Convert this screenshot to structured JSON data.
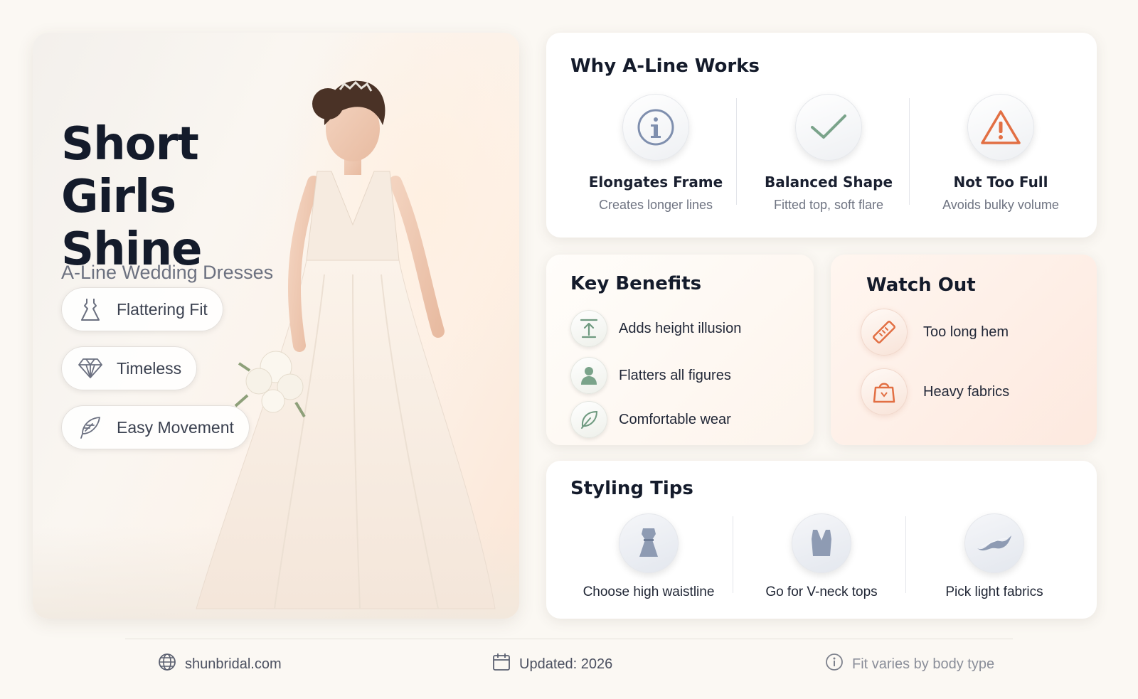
{
  "hero": {
    "title": "Short Girls Shine",
    "subtitle": "A-Line Wedding Dresses",
    "pills": [
      {
        "label": "Flattering Fit",
        "icon": "dress-icon"
      },
      {
        "label": "Timeless",
        "icon": "diamond-icon"
      },
      {
        "label": "Easy Movement",
        "icon": "feather-icon"
      }
    ]
  },
  "why": {
    "title": "Why A-Line Works",
    "items": [
      {
        "title": "Elongates Frame",
        "subtitle": "Creates longer lines",
        "icon": "info-icon"
      },
      {
        "title": "Balanced Shape",
        "subtitle": "Fitted top, soft flare",
        "icon": "checkmark-icon"
      },
      {
        "title": "Not Too Full",
        "subtitle": "Avoids bulky volume",
        "icon": "warning-icon"
      }
    ]
  },
  "benefits": {
    "title": "Key Benefits",
    "items": [
      {
        "label": "Adds height illusion",
        "icon": "height-arrow-icon"
      },
      {
        "label": "Flatters all figures",
        "icon": "person-icon"
      },
      {
        "label": "Comfortable wear",
        "icon": "leaf-icon"
      }
    ]
  },
  "watch": {
    "title": "Watch Out",
    "items": [
      {
        "label": "Too long hem",
        "icon": "ruler-icon"
      },
      {
        "label": "Heavy fabrics",
        "icon": "weight-bag-icon"
      }
    ]
  },
  "tips": {
    "title": "Styling Tips",
    "items": [
      {
        "label": "Choose high waistline",
        "icon": "dress-form-icon"
      },
      {
        "label": "Go for V-neck tops",
        "icon": "v-neck-top-icon"
      },
      {
        "label": "Pick light fabrics",
        "icon": "fabric-icon"
      }
    ]
  },
  "footer": {
    "website": "shunbridal.com",
    "updated": "Updated: 2026",
    "note": "Fit varies by body type"
  },
  "colors": {
    "title": "#141b2b",
    "accent_blue": "#7f8fae",
    "accent_green": "#7aa38a",
    "accent_orange": "#e26f43",
    "background": "#fbf8f3"
  }
}
